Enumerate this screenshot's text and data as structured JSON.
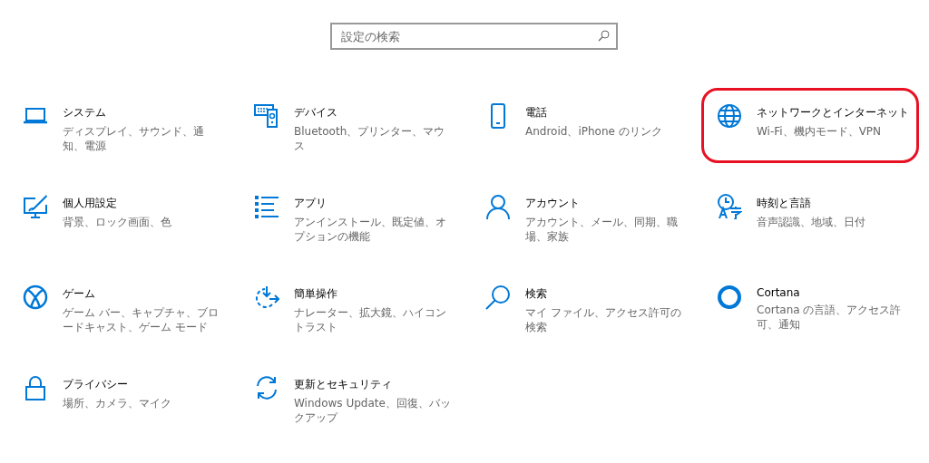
{
  "search": {
    "placeholder": "設定の検索"
  },
  "categories": [
    {
      "kind": "system",
      "title": "システム",
      "description": "ディスプレイ、サウンド、通知、電源",
      "highlighted": false
    },
    {
      "kind": "devices",
      "title": "デバイス",
      "description": "Bluetooth、プリンター、マウス",
      "highlighted": false
    },
    {
      "kind": "phone",
      "title": "電話",
      "description": "Android、iPhone のリンク",
      "highlighted": false
    },
    {
      "kind": "network",
      "title": "ネットワークとインターネット",
      "description": "Wi-Fi、機内モード、VPN",
      "highlighted": true
    },
    {
      "kind": "personalization",
      "title": "個人用設定",
      "description": "背景、ロック画面、色",
      "highlighted": false
    },
    {
      "kind": "apps",
      "title": "アプリ",
      "description": "アンインストール、既定値、オプションの機能",
      "highlighted": false
    },
    {
      "kind": "accounts",
      "title": "アカウント",
      "description": "アカウント、メール、同期、職場、家族",
      "highlighted": false
    },
    {
      "kind": "time",
      "title": "時刻と言語",
      "description": "音声認識、地域、日付",
      "highlighted": false
    },
    {
      "kind": "gaming",
      "title": "ゲーム",
      "description": "ゲーム バー、キャプチャ、ブロードキャスト、ゲーム モード",
      "highlighted": false
    },
    {
      "kind": "ease",
      "title": "簡単操作",
      "description": "ナレーター、拡大鏡、ハイコントラスト",
      "highlighted": false
    },
    {
      "kind": "search",
      "title": "検索",
      "description": "マイ ファイル、アクセス許可の検索",
      "highlighted": false
    },
    {
      "kind": "cortana",
      "title": "Cortana",
      "description": "Cortana の言語、アクセス許可、通知",
      "highlighted": false
    },
    {
      "kind": "privacy",
      "title": "プライバシー",
      "description": "場所、カメラ、マイク",
      "highlighted": false
    },
    {
      "kind": "update",
      "title": "更新とセキュリティ",
      "description": "Windows Update、回復、バックアップ",
      "highlighted": false
    }
  ]
}
